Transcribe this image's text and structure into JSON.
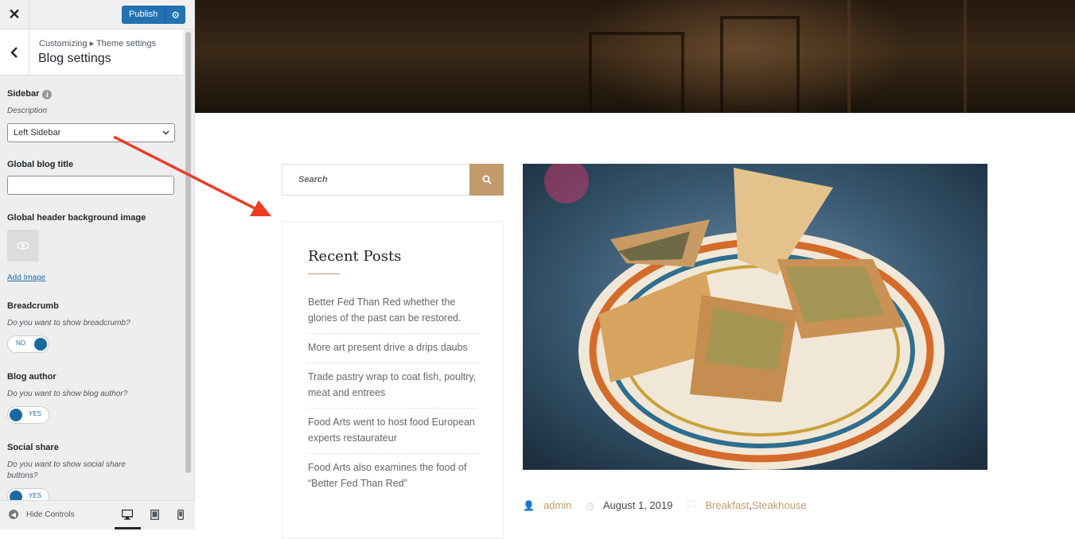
{
  "customizer": {
    "close_icon": "close-icon",
    "publish_label": "Publish",
    "breadcrumb": "Customizing ▸ Theme settings",
    "section_title": "Blog settings",
    "sidebar": {
      "label": "Sidebar",
      "description": "Description",
      "selected": "Left Sidebar"
    },
    "blog_title": {
      "label": "Global blog title",
      "value": ""
    },
    "header_image": {
      "label": "Global header background image",
      "add_link": "Add Image"
    },
    "breadcrumb_ctl": {
      "label": "Breadcrumb",
      "description": "Do you want to show breadcrumb?",
      "toggle": "NO"
    },
    "blog_author": {
      "label": "Blog author",
      "description": "Do you want to show blog author?",
      "toggle": "YES"
    },
    "social_share": {
      "label": "Social share",
      "description": "Do you want to show social share buttons?",
      "toggle": "YES"
    },
    "footer": {
      "hide_controls": "Hide Controls",
      "active_device": "desktop"
    },
    "accent": "#2271b1"
  },
  "preview": {
    "search_placeholder": "Search",
    "recent_posts_title": "Recent Posts",
    "recent_posts": [
      "Better Fed Than Red whether the glories of the past can be restored.",
      "More art present drive a drips daubs",
      "Trade pastry wrap to coat fish, poultry, meat and entrees",
      "Food Arts went to host food European experts restaurateur",
      "Food Arts also examines the food of “Better Fed Than Red”"
    ],
    "post_meta": {
      "author": "admin",
      "date": "August 1, 2019",
      "category_1": "Breakfast",
      "category_sep": ", ",
      "category_2": "Steakhouse"
    },
    "accent": "#c19b6c",
    "annotation_color": "#ee3b24"
  }
}
